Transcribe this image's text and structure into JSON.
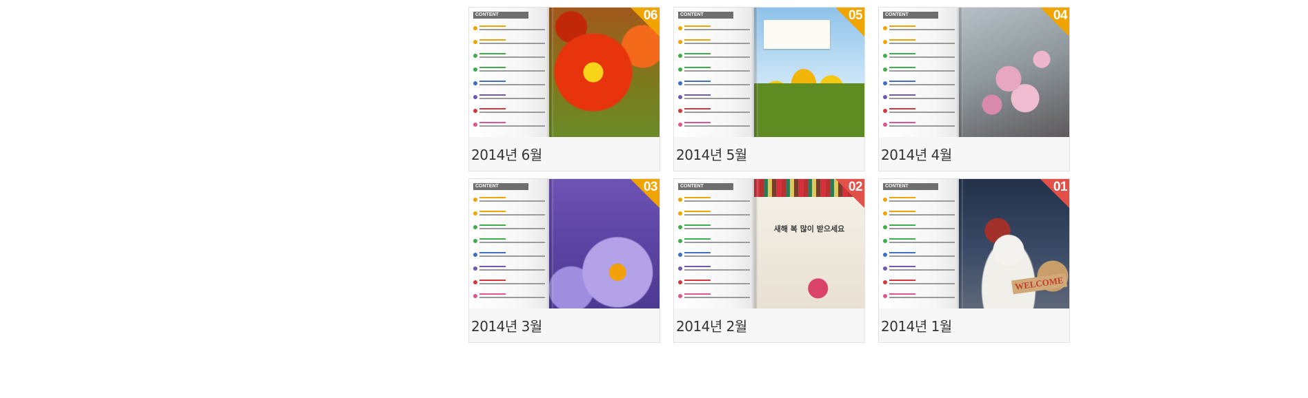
{
  "cards": [
    {
      "label": "2014년 6월",
      "issue": "06",
      "corner_color": "#f0a400",
      "toc_header": "CONTENT"
    },
    {
      "label": "2014년 5월",
      "issue": "05",
      "corner_color": "#f0a400",
      "toc_header": "CONTENT"
    },
    {
      "label": "2014년 4월",
      "issue": "04",
      "corner_color": "#f0a400",
      "toc_header": "CONTENT"
    },
    {
      "label": "2014년 3월",
      "issue": "03",
      "corner_color": "#f0a400",
      "toc_header": "CONTENT"
    },
    {
      "label": "2014년 2월",
      "issue": "02",
      "corner_color": "#e2504a",
      "toc_header": "CONTENT",
      "cover_heading": "새해 복 많이 받으세요",
      "cover_heading_accent": "복"
    },
    {
      "label": "2014년 1월",
      "issue": "01",
      "corner_color": "#e2504a",
      "toc_header": "CONTENT",
      "cover_badge": "WELCOME"
    }
  ],
  "toc_dot_colors": [
    "#f0a400",
    "#f0a400",
    "#3fae49",
    "#3fae49",
    "#3d6fc4",
    "#6e57b5",
    "#d6353b",
    "#e0558f"
  ]
}
